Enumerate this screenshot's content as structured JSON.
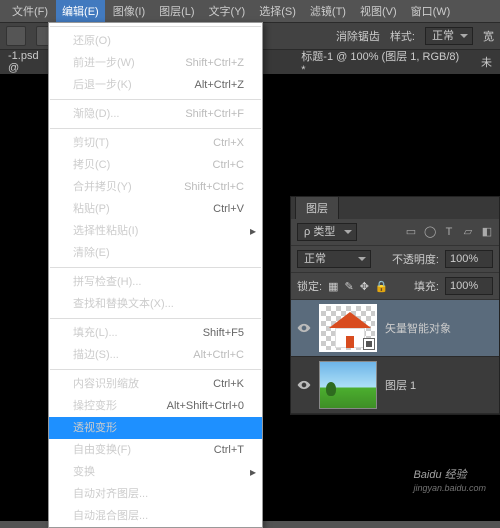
{
  "menubar": [
    "文件(F)",
    "编辑(E)",
    "图像(I)",
    "图层(L)",
    "文字(Y)",
    "选择(S)",
    "滤镜(T)",
    "视图(V)",
    "窗口(W)"
  ],
  "toolbar": {
    "anti_alias": "消除锯齿",
    "style_lbl": "样式:",
    "style_val": "正常",
    "width_lbl": "宽"
  },
  "tabs": [
    "-1.psd @",
    "标题-1 @ 100% (图层 1, RGB/8) *",
    "未"
  ],
  "dropdown": [
    {
      "t": "sep"
    },
    {
      "label": "还原(O)",
      "dis": true
    },
    {
      "label": "前进一步(W)",
      "sc": "Shift+Ctrl+Z",
      "dis": true
    },
    {
      "label": "后退一步(K)",
      "sc": "Alt+Ctrl+Z"
    },
    {
      "t": "sep"
    },
    {
      "label": "渐隐(D)...",
      "sc": "Shift+Ctrl+F",
      "dis": true
    },
    {
      "t": "sep"
    },
    {
      "label": "剪切(T)",
      "sc": "Ctrl+X",
      "dis": true
    },
    {
      "label": "拷贝(C)",
      "sc": "Ctrl+C",
      "dis": true
    },
    {
      "label": "合并拷贝(Y)",
      "sc": "Shift+Ctrl+C",
      "dis": true
    },
    {
      "label": "粘贴(P)",
      "sc": "Ctrl+V"
    },
    {
      "label": "选择性粘贴(I)",
      "sub": true
    },
    {
      "label": "清除(E)",
      "dis": true
    },
    {
      "t": "sep"
    },
    {
      "label": "拼写检查(H)...",
      "dis": true
    },
    {
      "label": "查找和替换文本(X)...",
      "dis": true
    },
    {
      "t": "sep"
    },
    {
      "label": "填充(L)...",
      "sc": "Shift+F5"
    },
    {
      "label": "描边(S)...",
      "sc": "Alt+Ctrl+C",
      "dis": true
    },
    {
      "t": "sep"
    },
    {
      "label": "内容识别缩放",
      "sc": "Ctrl+K"
    },
    {
      "label": "操控变形",
      "sc": "Alt+Shift+Ctrl+0"
    },
    {
      "label": "透视变形",
      "hi": true
    },
    {
      "label": "自由变换(F)",
      "sc": "Ctrl+T"
    },
    {
      "label": "变换",
      "sub": true
    },
    {
      "label": "自动对齐图层...",
      "dis": true
    },
    {
      "label": "自动混合图层...",
      "dis": true
    }
  ],
  "layers": {
    "tab": "图层",
    "kind_lbl": "ρ 类型",
    "icons": [
      "▭",
      "◯",
      "T",
      "▱",
      "◧"
    ],
    "blend": "正常",
    "opacity_lbl": "不透明度:",
    "opacity": "100%",
    "lock_lbl": "锁定:",
    "lock_icons": [
      "▦",
      "✎",
      "✥",
      "🔒"
    ],
    "fill_lbl": "填充:",
    "fill": "100%",
    "items": [
      {
        "name": "矢量智能对象",
        "smart": true,
        "sel": true,
        "thumb": "house"
      },
      {
        "name": "图层 1",
        "thumb": "land"
      }
    ]
  },
  "watermark": {
    "brand": "Baidu 经验",
    "url": "jingyan.baidu.com"
  }
}
